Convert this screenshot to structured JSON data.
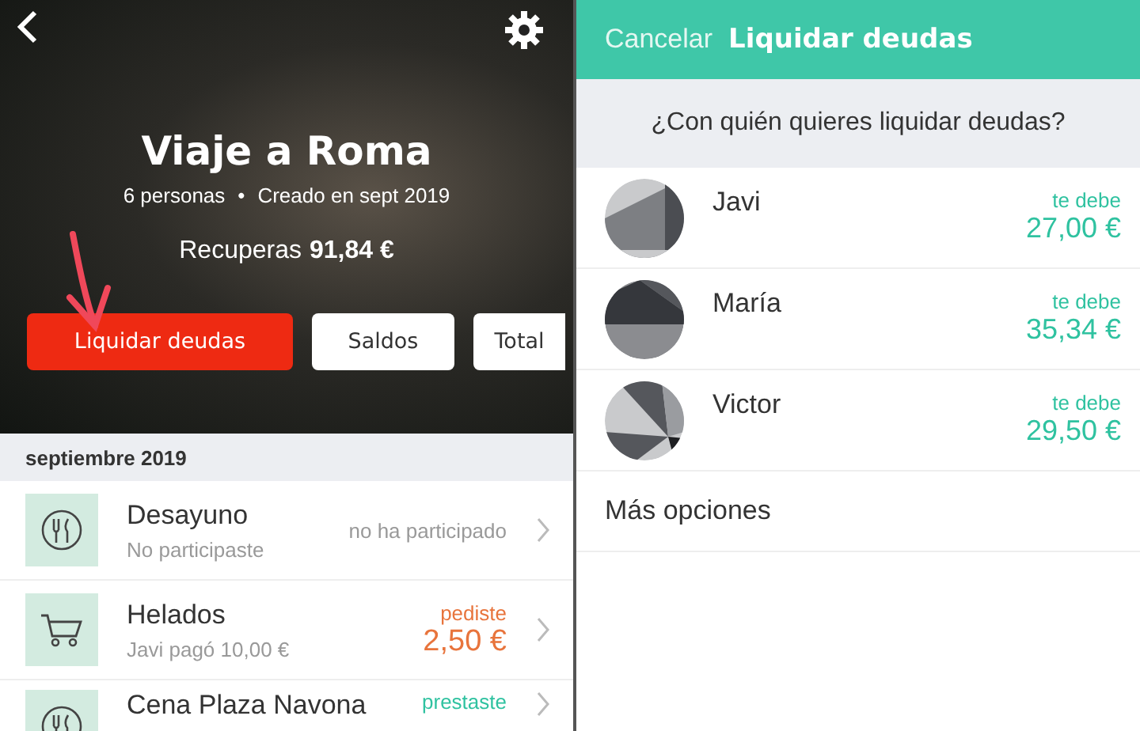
{
  "group_screen": {
    "title": "Viaje a Roma",
    "members": "6 personas",
    "separator": "•",
    "created": "Creado en sept 2019",
    "balance_label": "Recuperas",
    "balance_amount": "91,84 €",
    "actions": [
      {
        "label": "Liquidar deudas",
        "kind": "primary"
      },
      {
        "label": "Saldos",
        "kind": "secondary"
      },
      {
        "label": "Total",
        "kind": "secondary"
      }
    ],
    "section": "septiembre 2019",
    "expenses": [
      {
        "title": "Desayuno",
        "subtitle": "No participaste",
        "status": "no ha participado",
        "kind": "none"
      },
      {
        "title": "Helados",
        "subtitle": "Javi pagó 10,00 €",
        "status": "pediste",
        "amount": "2,50 €",
        "kind": "borrowed"
      },
      {
        "title": "Cena Plaza Navona",
        "status": "prestaste",
        "kind": "lent"
      }
    ]
  },
  "settle_screen": {
    "cancel": "Cancelar",
    "title": "Liquidar deudas",
    "question": "¿Con quién quieres liquidar deudas?",
    "people": [
      {
        "name": "Javi",
        "label": "te debe",
        "amount": "27,00 €"
      },
      {
        "name": "María",
        "label": "te debe",
        "amount": "35,34 €"
      },
      {
        "name": "Victor",
        "label": "te debe",
        "amount": "29,50 €"
      }
    ],
    "more": "Más opciones"
  }
}
